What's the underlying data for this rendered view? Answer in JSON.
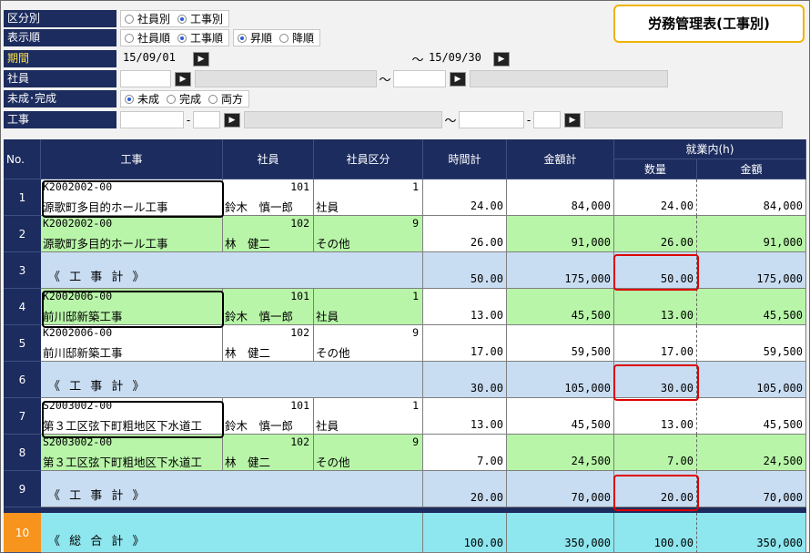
{
  "title": "労務管理表(工事別)",
  "filters": {
    "kubun": {
      "label": "区分別",
      "options": [
        {
          "label": "社員別",
          "selected": false
        },
        {
          "label": "工事別",
          "selected": true
        }
      ]
    },
    "order": {
      "label": "表示順",
      "options": [
        {
          "label": "社員順",
          "selected": false
        },
        {
          "label": "工事順",
          "selected": true
        }
      ],
      "dir_options": [
        {
          "label": "昇順",
          "selected": true
        },
        {
          "label": "降順",
          "selected": false
        }
      ]
    },
    "period": {
      "label": "期間",
      "from": "15/09/01",
      "tilde": "～",
      "to": "15/09/30"
    },
    "employee": {
      "label": "社員",
      "tilde": "～"
    },
    "status": {
      "label": "未成･完成",
      "options": [
        {
          "label": "未成",
          "selected": true
        },
        {
          "label": "完成",
          "selected": false
        },
        {
          "label": "両方",
          "selected": false
        }
      ]
    },
    "project": {
      "label": "工事",
      "dash": "-",
      "tilde": "～"
    }
  },
  "grid": {
    "headers": {
      "no": "No.",
      "project": "工事",
      "employee": "社員",
      "emp_class": "社員区分",
      "hours": "時間計",
      "amount": "金額計",
      "within": "就業内(h)",
      "qty": "数量",
      "within_amount": "金額"
    },
    "rows": [
      {
        "no": "1",
        "type": "detail",
        "bg": "#ffffff",
        "code": "K2002002-00",
        "name": "源歌町多目的ホール工事",
        "emp_no": "101",
        "emp_name": "鈴木　慎一郎",
        "class_no": "1",
        "class_name": "社員",
        "hours": "24.00",
        "amount": "84,000",
        "qty": "24.00",
        "within_amount": "84,000"
      },
      {
        "no": "2",
        "type": "detail",
        "bg": "#b8f5a8",
        "code": "K2002002-00",
        "name": "源歌町多目的ホール工事",
        "emp_no": "102",
        "emp_name": "林　健二",
        "class_no": "9",
        "class_name": "その他",
        "hours": "26.00",
        "amount": "91,000",
        "qty": "26.00",
        "within_amount": "91,000"
      },
      {
        "no": "3",
        "type": "subtotal",
        "bg": "#c9ddf2",
        "label": "《 工 事 計 》",
        "hours": "50.00",
        "amount": "175,000",
        "qty": "50.00",
        "within_amount": "175,000"
      },
      {
        "no": "4",
        "type": "detail",
        "bg": "#b8f5a8",
        "code": "K2002006-00",
        "name": "前川邸新築工事",
        "emp_no": "101",
        "emp_name": "鈴木　慎一郎",
        "class_no": "1",
        "class_name": "社員",
        "hours": "13.00",
        "amount": "45,500",
        "qty": "13.00",
        "within_amount": "45,500"
      },
      {
        "no": "5",
        "type": "detail",
        "bg": "#ffffff",
        "code": "K2002006-00",
        "name": "前川邸新築工事",
        "emp_no": "102",
        "emp_name": "林　健二",
        "class_no": "9",
        "class_name": "その他",
        "hours": "17.00",
        "amount": "59,500",
        "qty": "17.00",
        "within_amount": "59,500"
      },
      {
        "no": "6",
        "type": "subtotal",
        "bg": "#c9ddf2",
        "label": "《 工 事 計 》",
        "hours": "30.00",
        "amount": "105,000",
        "qty": "30.00",
        "within_amount": "105,000"
      },
      {
        "no": "7",
        "type": "detail",
        "bg": "#ffffff",
        "code": "S2003002-00",
        "name": "第３工区弦下町粗地区下水道工",
        "emp_no": "101",
        "emp_name": "鈴木　慎一郎",
        "class_no": "1",
        "class_name": "社員",
        "hours": "13.00",
        "amount": "45,500",
        "qty": "13.00",
        "within_amount": "45,500"
      },
      {
        "no": "8",
        "type": "detail",
        "bg": "#b8f5a8",
        "code": "S2003002-00",
        "name": "第３工区弦下町粗地区下水道工",
        "emp_no": "102",
        "emp_name": "林　健二",
        "class_no": "9",
        "class_name": "その他",
        "hours": "7.00",
        "amount": "24,500",
        "qty": "7.00",
        "within_amount": "24,500"
      },
      {
        "no": "9",
        "type": "subtotal",
        "bg": "#c9ddf2",
        "label": "《 工 事 計 》",
        "hours": "20.00",
        "amount": "70,000",
        "qty": "20.00",
        "within_amount": "70,000"
      },
      {
        "no": "10",
        "type": "total",
        "bg": "#8ee6ee",
        "label": "《 総 合 計 》",
        "hours": "100.00",
        "amount": "350,000",
        "qty": "100.00",
        "within_amount": "350,000"
      }
    ]
  },
  "colors": {
    "header_bg": "#1c2c5e",
    "title_border": "#f0b400",
    "total_rowno": "#f7941d",
    "highlight_red": "#e00000"
  }
}
